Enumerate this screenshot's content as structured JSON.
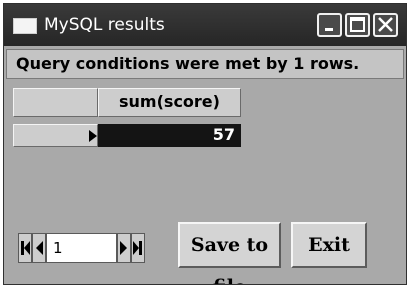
{
  "window": {
    "title": "MySQL results"
  },
  "status": {
    "message": "Query conditions were met by 1 rows."
  },
  "grid": {
    "columns": [
      "sum(score)"
    ],
    "rows": [
      [
        "57"
      ]
    ]
  },
  "navigator": {
    "record_value": "1"
  },
  "buttons": {
    "save_label": "Save to file",
    "exit_label": "Exit"
  },
  "icons": {
    "window_icon": "window-icon",
    "minimize": "minimize-icon",
    "maximize": "maximize-icon",
    "close": "close-icon",
    "row_pointer": "current-row-arrow-icon",
    "first": "first-record-icon",
    "prev": "previous-record-icon",
    "next": "next-record-icon",
    "last": "last-record-icon"
  },
  "colors": {
    "titlebar": "#2f2f2f",
    "window_body": "#a9a9a9",
    "selected_cell": "#141414",
    "button_face": "#d4d4d4"
  }
}
